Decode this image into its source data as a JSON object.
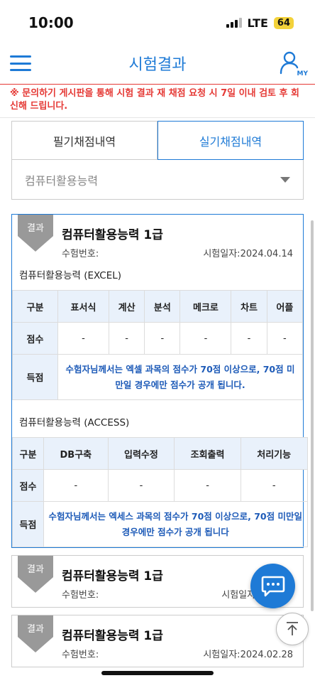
{
  "status_bar": {
    "time": "10:00",
    "network": "LTE",
    "battery": "64"
  },
  "header": {
    "title": "시험결과",
    "my_label": "MY"
  },
  "notice": "※ 문의하기 게시판을 통해 시험 결과 재 채점 요청 시 7일 이내 검토 후 회신해 드립니다.",
  "tabs": {
    "written": "필기채점내역",
    "practical": "실기채점내역"
  },
  "select": {
    "value": "컴퓨터활용능력"
  },
  "cards": [
    {
      "badge": "결과",
      "title": "컴퓨터활용능력 1급",
      "exam_number_label": "수험번호:",
      "exam_date": "시험일자:2024.04.14",
      "excel": {
        "label": "컴퓨터활용능력 (EXCEL)",
        "headers": [
          "구분",
          "표서식",
          "계산",
          "분석",
          "메크로",
          "차트",
          "어플"
        ],
        "score_label": "점수",
        "scores": [
          "-",
          "-",
          "-",
          "-",
          "-",
          "-"
        ],
        "result_label": "득점",
        "note": "수험자님께서는 엑셀 과목의 점수가 70점 이상으로, 70점 미만일 경우에만 점수가 공개 됩니다."
      },
      "access": {
        "label": "컴퓨터활용능력 (ACCESS)",
        "headers": [
          "구분",
          "DB구축",
          "입력수정",
          "조회출력",
          "처리기능"
        ],
        "score_label": "점수",
        "scores": [
          "-",
          "-",
          "-",
          "-",
          "-"
        ],
        "result_label": "득점",
        "note": "수험자님께서는 엑세스 과목의 점수가 70점 이상으로, 70점 미만일 경우에만 점수가 공개 됩니다"
      }
    },
    {
      "badge": "결과",
      "title": "컴퓨터활용능력 1급",
      "exam_number_label": "수험번호:",
      "exam_date": "시험일자:20"
    },
    {
      "badge": "결과",
      "title": "컴퓨터활용능력 1급",
      "exam_number_label": "수험번호:",
      "exam_date": "시험일자:2024.02.28"
    }
  ],
  "colors": {
    "accent": "#1e7ad6",
    "notice": "#e53935",
    "ribbon": "#999999",
    "table_head": "#e9f1fb"
  }
}
